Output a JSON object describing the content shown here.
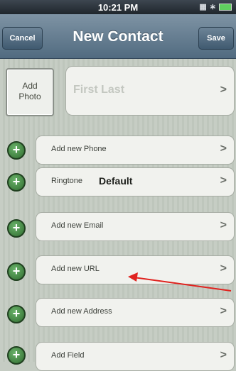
{
  "status_bar": {
    "time": "10:21 PM",
    "icons": [
      "signal-icon",
      "bluetooth-icon",
      "battery-icon"
    ]
  },
  "nav": {
    "title": "New Contact",
    "cancel_label": "Cancel",
    "save_label": "Save"
  },
  "photo": {
    "label": "Add\nPhoto"
  },
  "name_field": {
    "placeholder": "First Last"
  },
  "rows": [
    {
      "label": "Add new Phone"
    },
    {
      "label": "Ringtone",
      "value": "Default"
    },
    {
      "label": "Add new Email"
    },
    {
      "label": "Add new URL"
    },
    {
      "label": "Add new Address"
    },
    {
      "label": "Add Field"
    }
  ],
  "chevron_glyph": ">",
  "plus_glyph": "+",
  "colors": {
    "nav": "#5d7589",
    "annotation_arrow": "#e0231f",
    "add_button": "#3c7d3c"
  }
}
